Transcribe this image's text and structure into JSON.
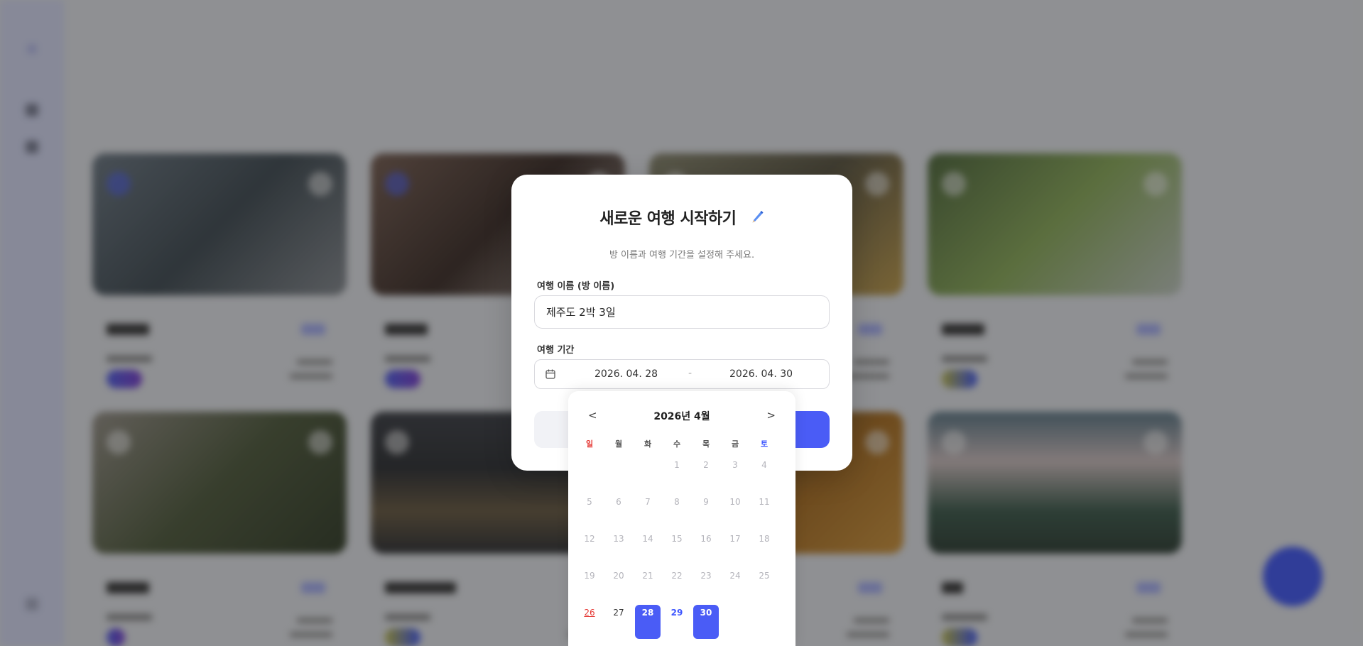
{
  "modal": {
    "title": "새로운 여행 시작하기",
    "subtitle": "방 이름과 여행 기간을 설정해 주세요.",
    "name_label": "여행 이름 (방 이름)",
    "name_value": "제주도 2박 3일",
    "period_label": "여행 기간",
    "start_date": "2026. 04. 28",
    "separator": "-",
    "end_date": "2026. 04. 30"
  },
  "calendar": {
    "prev": "<",
    "next": ">",
    "month_label": "2026년 4월",
    "weekdays": [
      "일",
      "월",
      "화",
      "수",
      "목",
      "금",
      "토"
    ],
    "weekday_colors": {
      "sunday": "#e53935",
      "saturday": "#3f57ff"
    },
    "weeks": [
      [
        "",
        "",
        "",
        "1",
        "2",
        "3",
        "4"
      ],
      [
        "5",
        "6",
        "7",
        "8",
        "9",
        "10",
        "11"
      ],
      [
        "12",
        "13",
        "14",
        "15",
        "16",
        "17",
        "18"
      ],
      [
        "19",
        "20",
        "21",
        "22",
        "23",
        "24",
        "25"
      ],
      [
        "26",
        "27",
        "28",
        "29",
        "30",
        "",
        ""
      ]
    ],
    "today": "26",
    "range_start": "28",
    "range_end": "30",
    "in_range": [
      "29"
    ],
    "selectable": [
      "26",
      "27",
      "28",
      "29",
      "30"
    ],
    "accent_color": "#4a5cf6"
  }
}
